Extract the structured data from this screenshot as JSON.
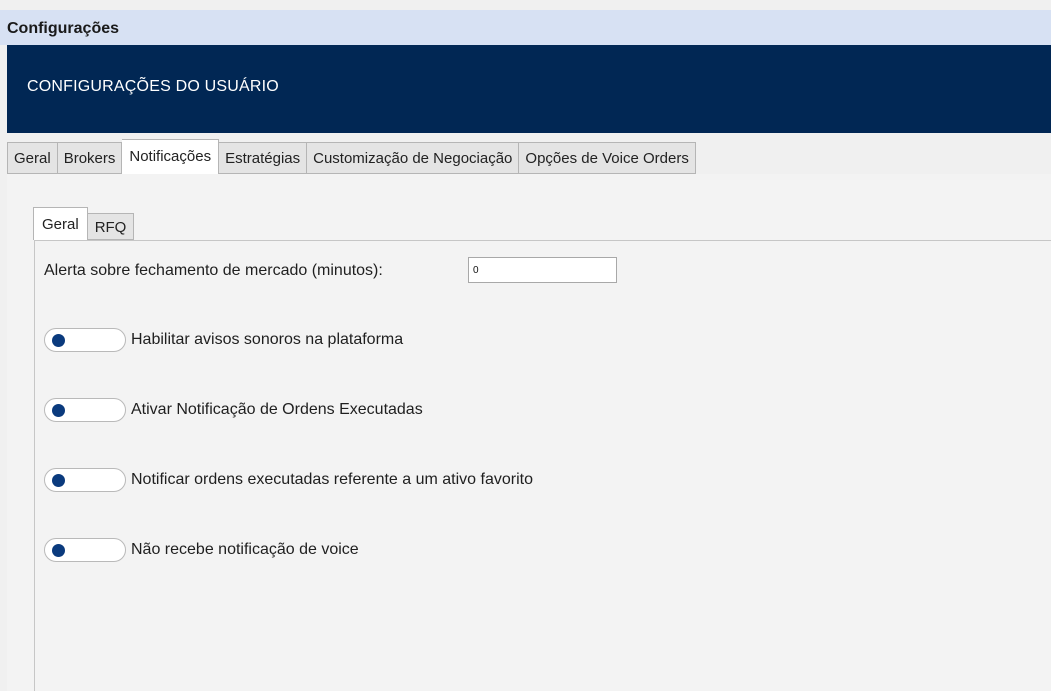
{
  "window": {
    "title": "Configurações"
  },
  "banner": {
    "title": "CONFIGURAÇÕES DO USUÁRIO"
  },
  "main_tabs": [
    {
      "label": "Geral",
      "active": false
    },
    {
      "label": "Brokers",
      "active": false
    },
    {
      "label": "Notificações",
      "active": true
    },
    {
      "label": "Estratégias",
      "active": false
    },
    {
      "label": "Customização de Negociação",
      "active": false
    },
    {
      "label": "Opções de Voice Orders",
      "active": false
    }
  ],
  "sub_tabs": [
    {
      "label": "Geral",
      "active": true
    },
    {
      "label": "RFQ",
      "active": false
    }
  ],
  "market_close_alert": {
    "label": "Alerta sobre fechamento de mercado (minutos):",
    "value": "0"
  },
  "toggles": [
    {
      "label": "Habilitar avisos sonoros na plataforma",
      "on": false
    },
    {
      "label": "Ativar Notificação de Ordens Executadas",
      "on": false
    },
    {
      "label": "Notificar ordens executadas referente a um ativo favorito",
      "on": false
    },
    {
      "label": "Não recebe notificação de voice",
      "on": false
    }
  ],
  "colors": {
    "title_bar": "#d7e1f3",
    "banner": "#012754",
    "toggle_knob": "#0a3a7d"
  }
}
